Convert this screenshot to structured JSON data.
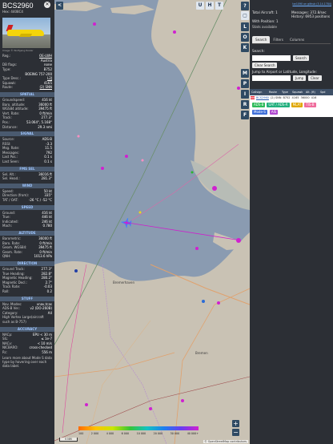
{
  "aircraft": {
    "callsign": "BCS2960",
    "hex": "Hex: 4408C4",
    "photo_credit": "Image © Wolfgang Rosler",
    "fields": [
      {
        "k": "Reg.:",
        "v": "OE-LWH",
        "link": true
      },
      {
        "k": "",
        "v": "Austria"
      },
      {
        "k": "DB flags:",
        "v": "none"
      },
      {
        "k": "Type:",
        "v": "B752"
      },
      {
        "k": "",
        "v": "BOEING 757-200"
      },
      {
        "k": "Type Desc.:",
        "v": "L2J",
        "link": true
      },
      {
        "k": "Squawk:",
        "v": "4165"
      },
      {
        "k": "Route:",
        "v": "(2) SNN",
        "link": true
      }
    ]
  },
  "sections": [
    {
      "title": "SPATIAL",
      "rows": [
        {
          "k": "Groundspeed:",
          "v": "416 kt"
        },
        {
          "k": "Baro. altitude:",
          "v": "36000 ft"
        },
        {
          "k": "WGS84 altitude:",
          "v": "39475 ft"
        },
        {
          "k": "Vert. Rate:",
          "v": "0 ft/min"
        },
        {
          "k": "Track:",
          "v": "277.3°"
        },
        {
          "k": "Pos.:",
          "v": "53.064°, 5.168°"
        },
        {
          "k": "Distance:",
          "v": "29.3 nmi"
        }
      ]
    },
    {
      "title": "SIGNAL",
      "rows": [
        {
          "k": "Source:",
          "v": "ADS-B"
        },
        {
          "k": "RSSI:",
          "v": "-3.3"
        },
        {
          "k": "Msg. Rate:",
          "v": "11.5"
        },
        {
          "k": "Messages:",
          "v": "792"
        },
        {
          "k": "Last Pos.:",
          "v": "0.1 s"
        },
        {
          "k": "Last Seen:",
          "v": "0.1 s"
        }
      ]
    },
    {
      "title": "FMS SEL",
      "rows": [
        {
          "k": "Sel. Alt.:",
          "v": "36016 ft"
        },
        {
          "k": "Sel. Head.:",
          "v": "281.3°"
        }
      ]
    },
    {
      "title": "WIND",
      "rows": [
        {
          "k": "Speed:",
          "v": "50 kt"
        },
        {
          "k": "Direction (from):",
          "v": "335°"
        },
        {
          "k": "TAT / OAT:",
          "v": "-26 °C / -52 °C"
        }
      ]
    },
    {
      "title": "SPEED",
      "rows": [
        {
          "k": "Ground:",
          "v": "416 kt"
        },
        {
          "k": "True:",
          "v": "446 kt"
        },
        {
          "k": "Indicated:",
          "v": "246 kt"
        },
        {
          "k": "Mach:",
          "v": "0.780"
        }
      ]
    },
    {
      "title": "ALTITUDE",
      "rows": [
        {
          "k": "Barometric:",
          "v": "36000 ft"
        },
        {
          "k": "Baro. Rate:",
          "v": "0 ft/min"
        },
        {
          "k": "Geom. WGS84:",
          "v": "39475 ft"
        },
        {
          "k": "Geom. Rate:",
          "v": "0 ft/min"
        },
        {
          "k": "QNH:",
          "v": "1013.6 hPa"
        }
      ]
    },
    {
      "title": "DIRECTION",
      "rows": [
        {
          "k": "Ground Track:",
          "v": "277.3°"
        },
        {
          "k": "True Heading:",
          "v": "282.8°"
        },
        {
          "k": "Magnetic Heading:",
          "v": "280.2°"
        },
        {
          "k": "Magnetic Decl.:",
          "v": "2.7°"
        },
        {
          "k": "Track Rate:",
          "v": "-0.03"
        },
        {
          "k": "Roll:",
          "v": "0.2"
        }
      ]
    },
    {
      "title": "STUFF",
      "rows": [
        {
          "k": "Nav. Modes:",
          "v": "vnav,tcas"
        },
        {
          "k": "ADS-B Ver.:",
          "v": "v2 (DO-260B)"
        },
        {
          "k": "Category:",
          "v": "A4"
        },
        {
          "k": "High Vortex Large(aircraft",
          "v": ""
        },
        {
          "k": "such as B-757)",
          "v": ""
        }
      ]
    },
    {
      "title": "ACCURACY",
      "rows": [
        {
          "k": "NACp:",
          "v": "EPU < 30 m"
        },
        {
          "k": "SIL:",
          "v": "≤ 1e-7"
        },
        {
          "k": "NACv:",
          "v": "< 10 m/s"
        },
        {
          "k": "NICBARO:",
          "v": "cross-checked"
        },
        {
          "k": "Rc:",
          "v": "556 m"
        }
      ]
    }
  ],
  "info_footer": "Learn more about Mode S data type by hovering over each data label.",
  "map": {
    "top_buttons": [
      "U",
      "H",
      "T"
    ],
    "left_button": "<",
    "right_buttons": [
      "?",
      "▢"
    ],
    "side_buttons": [
      "L",
      "O",
      "K",
      "M",
      "P",
      "I",
      "R",
      "F"
    ],
    "places": [
      {
        "name": "Bremerhaven",
        "id": "bremerhaven"
      },
      {
        "name": "Bremen",
        "id": "bremen"
      }
    ],
    "legend_labels": [
      "100",
      "2 000",
      "4 000",
      "6 000",
      "10 000",
      "20 000",
      "30 000",
      "40 000+"
    ],
    "scale": "5 NM",
    "attribution": "© OpenStreetMap contributors."
  },
  "panel": {
    "version": "tar1090 on github (3.14.1784)",
    "stats_left": [
      "Total Aircraft: 1",
      "",
      "With Position: 1"
    ],
    "stats_right": [
      "Messages: 372.8/sec",
      "History: 6953 positions"
    ],
    "stats_link": "Stats available",
    "tabs": [
      "Search",
      "Filters",
      "Columns"
    ],
    "search_label": "Search:",
    "search_placeholder": "",
    "search_button": "Search",
    "clear_search": "Clear Search",
    "jump_label": "Jump to Airport or Latitude, Longitude:",
    "jump_button": "Jump",
    "clear_button": "Clear",
    "table_headers": [
      "Callsign",
      "Route",
      "Type",
      "Squawk",
      "Alt. (ft)",
      "Spd"
    ],
    "table_row": {
      "callsign": "BCS2960",
      "route": "(2) SNN",
      "type": "B752",
      "squawk": "4165",
      "alt": "36000",
      "spd": "416"
    },
    "chips": [
      {
        "label": "ADS-B",
        "color": "#2dbb5b"
      },
      {
        "label": "UAT / ADS-R",
        "color": "#22b07e"
      },
      {
        "label": "MLAT",
        "color": "#e0a700"
      },
      {
        "label": "TIS-B",
        "color": "#ef6c9c"
      }
    ],
    "chips2": [
      {
        "label": "Mode-S",
        "color": "#3f6fd8"
      },
      {
        "label": "AIS",
        "color": "#b04ad0"
      }
    ]
  },
  "colors": {
    "land": "#c9c2b4",
    "water": "#8a9bb1",
    "track": "#cc22cc",
    "highlight": "#3a86ff"
  }
}
